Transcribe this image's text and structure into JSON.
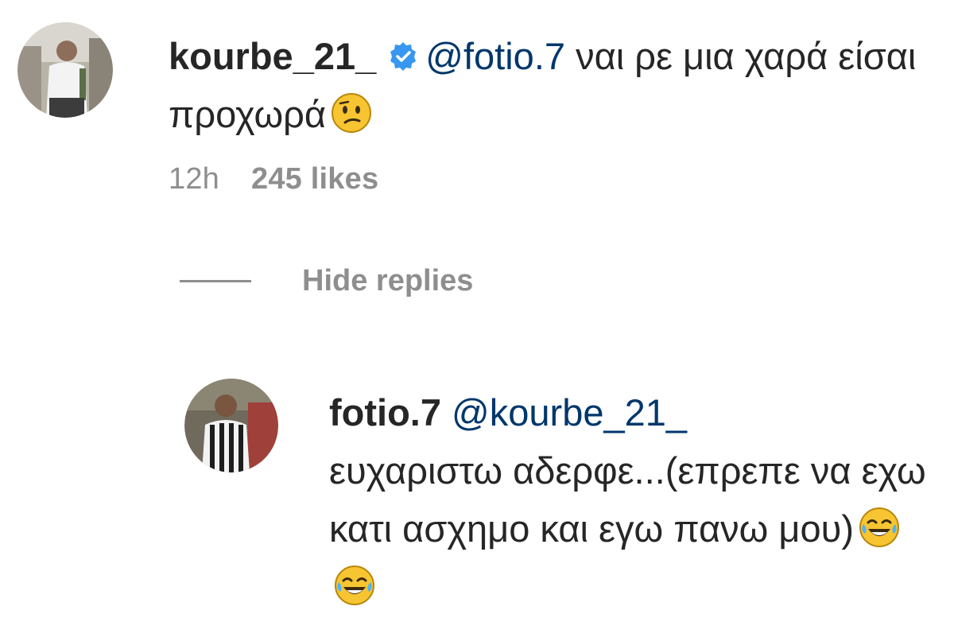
{
  "comments": {
    "main": {
      "username": "kourbe_21_",
      "verified": true,
      "mention": "@fotio.7",
      "text": "ναι ρε μια χαρά είσαι προχωρά",
      "emoji": "confused-face-emoji",
      "time": "12h",
      "likes": "245 likes"
    },
    "hide_replies_label": "Hide replies",
    "reply": {
      "username": "fotio.7",
      "mention": "@kourbe_21_",
      "text": "ευχαριστω αδερφε...(επρεπε να εχω κατι ασχημο και εγω πανω μου)",
      "emojis": [
        "tears-of-joy-emoji",
        "tears-of-joy-emoji"
      ]
    }
  },
  "colors": {
    "text": "#262626",
    "mention": "#00376b",
    "secondary": "#8e8e8e",
    "verified": "#3897f0"
  }
}
